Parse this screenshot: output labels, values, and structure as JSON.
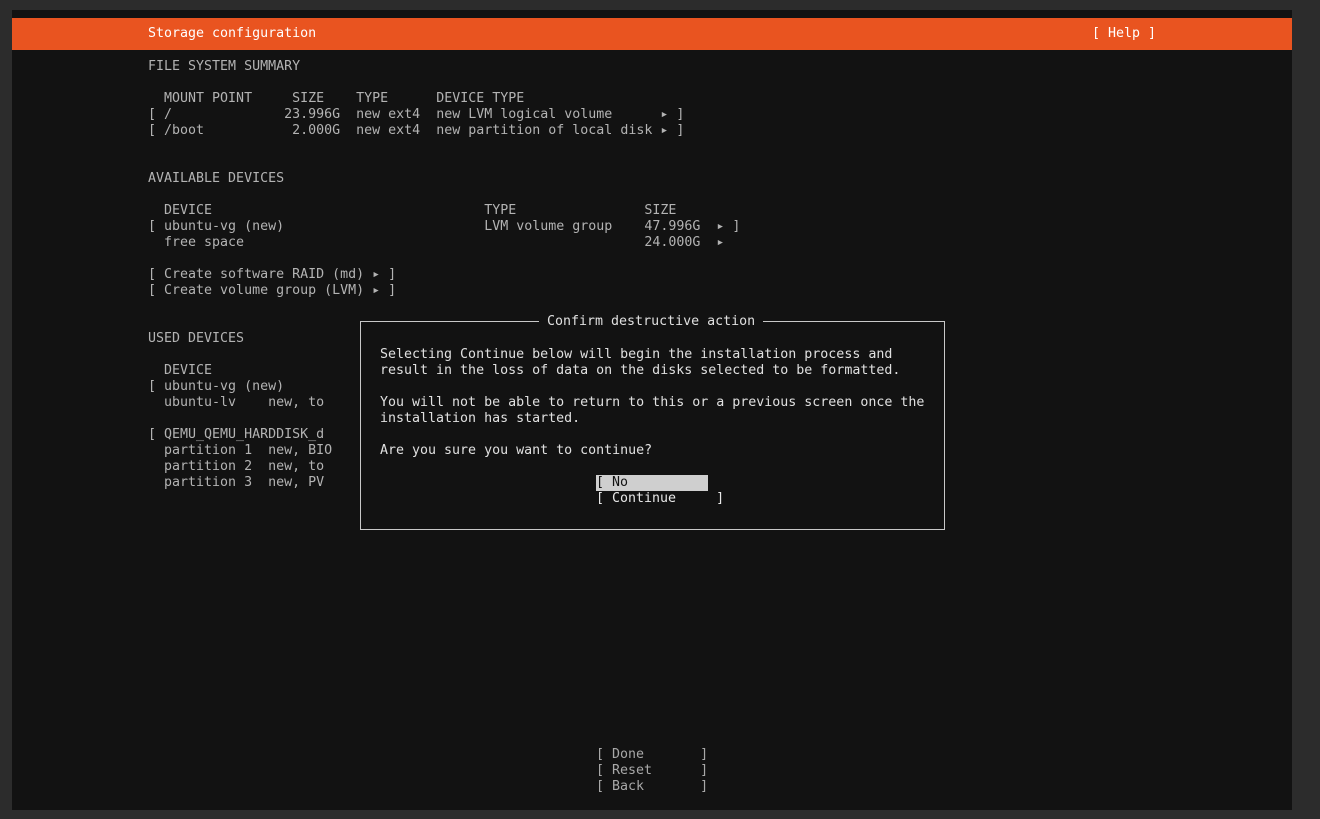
{
  "header": {
    "title": "Storage configuration",
    "help": "[ Help ]"
  },
  "fs_summary": {
    "heading": "FILE SYSTEM SUMMARY",
    "columns_line": "  MOUNT POINT     SIZE    TYPE      DEVICE TYPE",
    "rows": [
      "[ /              23.996G  new ext4  new LVM logical volume      ▸ ]",
      "[ /boot           2.000G  new ext4  new partition of local disk ▸ ]"
    ]
  },
  "available_devices": {
    "heading": "AVAILABLE DEVICES",
    "columns_line": "  DEVICE                                  TYPE                SIZE",
    "rows": [
      "[ ubuntu-vg (new)                         LVM volume group    47.996G  ▸ ]",
      "  free space                                                  24.000G  ▸"
    ],
    "actions": [
      "[ Create software RAID (md) ▸ ]",
      "[ Create volume group (LVM) ▸ ]"
    ]
  },
  "used_devices": {
    "heading": "USED DEVICES",
    "columns_line": "  DEVICE",
    "rows": [
      "[ ubuntu-vg (new)",
      "  ubuntu-lv    new, to",
      "",
      "[ QEMU_QEMU_HARDDISK_d",
      "  partition 1  new, BIO",
      "  partition 2  new, to",
      "  partition 3  new, PV"
    ]
  },
  "dialog": {
    "title": "Confirm destructive action",
    "lines": [
      "Selecting Continue below will begin the installation process and",
      "result in the loss of data on the disks selected to be formatted.",
      "",
      "You will not be able to return to this or a previous screen once the",
      "installation has started.",
      "",
      "Are you sure you want to continue?"
    ],
    "no_button": "[ No           ]",
    "continue_button": "[ Continue     ]"
  },
  "footer": {
    "done": "[ Done       ]",
    "reset": "[ Reset      ]",
    "back": "[ Back       ]"
  }
}
